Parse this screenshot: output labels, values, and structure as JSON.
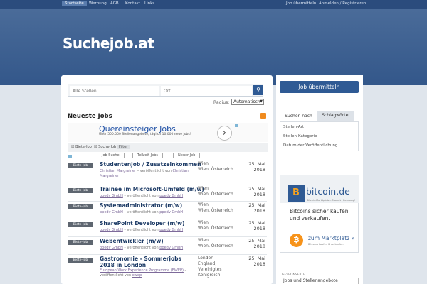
{
  "topnav": {
    "left": [
      "Startseite",
      "Werbung",
      "AGB",
      "Kontakt",
      "Links"
    ],
    "right": [
      "Job übermitteln",
      "Anmelden / Registrieren"
    ]
  },
  "logo": "Suchejob.at",
  "search": {
    "keyword_placeholder": "Alle Stellen",
    "location_placeholder": "Ort",
    "button_icon": "search-icon",
    "radius_label": "Radius:",
    "radius_value": "Automatisch"
  },
  "latest": {
    "title": "Neueste Jobs"
  },
  "ad": {
    "title": "Quereinsteiger Jobs",
    "description": "Über 500.000 Stellenangebote, täglich 10.000 neue Jobs!",
    "filters": [
      "Biete-Job",
      "Suche-Job",
      "Filter"
    ],
    "tabs": [
      "Job Suche",
      "Teilzeit Jobs",
      "Neuer Job"
    ]
  },
  "jobs": [
    {
      "badge": "Biete-Job",
      "title": "Studentenjob / Zusatzeinkommen",
      "company": "Christian Margreiner",
      "posted": "– veröffentlicht von",
      "poster": "Christian Margreiner",
      "location": "Wien\nWien, Österreich",
      "date": "25. Mai\n2018"
    },
    {
      "badge": "Biete-Job",
      "title": "Trainee im Microsoft-Umfeld (m/w)",
      "company": "ppedv GmbH",
      "posted": "– veröffentlicht von",
      "poster": "ppedv GmbH",
      "location": "Wien\nWien, Österreich",
      "date": "25. Mai\n2018"
    },
    {
      "badge": "Biete-Job",
      "title": "Systemadministrator (m/w)",
      "company": "ppedv GmbH",
      "posted": "– veröffentlicht von",
      "poster": "ppedv GmbH",
      "location": "Wien\nWien, Österreich",
      "date": "25. Mai\n2018"
    },
    {
      "badge": "Biete-Job",
      "title": "SharePoint Developer (m/w)",
      "company": "ppedv GmbH",
      "posted": "– veröffentlicht von",
      "poster": "ppedv GmbH",
      "location": "Wien\nWien, Österreich",
      "date": "25. Mai\n2018"
    },
    {
      "badge": "Biete-Job",
      "title": "Webentwickler (m/w)",
      "company": "ppedv GmbH",
      "posted": "– veröffentlicht von",
      "poster": "ppedv GmbH",
      "location": "Wien\nWien, Österreich",
      "date": "25. Mai\n2018"
    },
    {
      "badge": "Biete-Job",
      "title": "Gastronomie - Sommerjobs 2018 in London",
      "company": "European Work Experience Programme (EWEP)",
      "posted": "– veröffentlicht von",
      "poster": "ewep",
      "location": "London\nEngland, Vereinigtes Königreich",
      "date": "25. Mai\n2018"
    }
  ],
  "sidebar": {
    "submit_button": "Job übermitteln",
    "tabs": [
      "Suchen nach",
      "Schlagwörter"
    ],
    "items": [
      "Stellen-Art",
      "Stellen-Kategorie",
      "Datum der Veröffentlichung"
    ]
  },
  "bitcoin_ad": {
    "logo_glyph": "B",
    "name": "bitcoin.de",
    "subline": "Bitcoin-Marktplatz – Made in Germany!",
    "claim": "Bitcoins sicher kaufen und verkaufen.",
    "coin_glyph": "₿",
    "cta": "zum Marktplatz »",
    "cta_sub": "Bitcoins kaufen & verkaufen"
  },
  "sponsored": {
    "label": "GESPONSERTE",
    "box": "Jobs und Stellenangebote"
  },
  "colors": {
    "header_blue": "#33578a",
    "accent_blue": "#2f5a94",
    "badge_gray": "#5e6670",
    "bitcoin_orange": "#f7931a"
  }
}
